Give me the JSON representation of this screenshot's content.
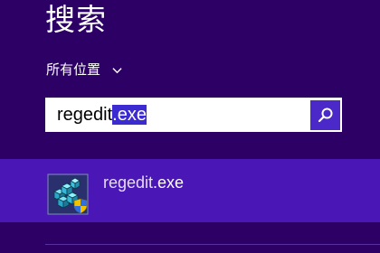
{
  "header": {
    "title": "搜索"
  },
  "scope": {
    "label": "所有位置",
    "icon": "chevron-down-icon"
  },
  "search": {
    "text_unselected": "regedit",
    "text_selected": ".exe",
    "button_icon": "search-icon"
  },
  "results": [
    {
      "name_base": "regedit",
      "name_ext": ".exe",
      "icon": "registry-editor-icon"
    }
  ],
  "colors": {
    "background": "#2d0066",
    "result_highlight": "#4a16b5",
    "search_button": "#4b28c8",
    "selection": "#3b2bd0"
  }
}
